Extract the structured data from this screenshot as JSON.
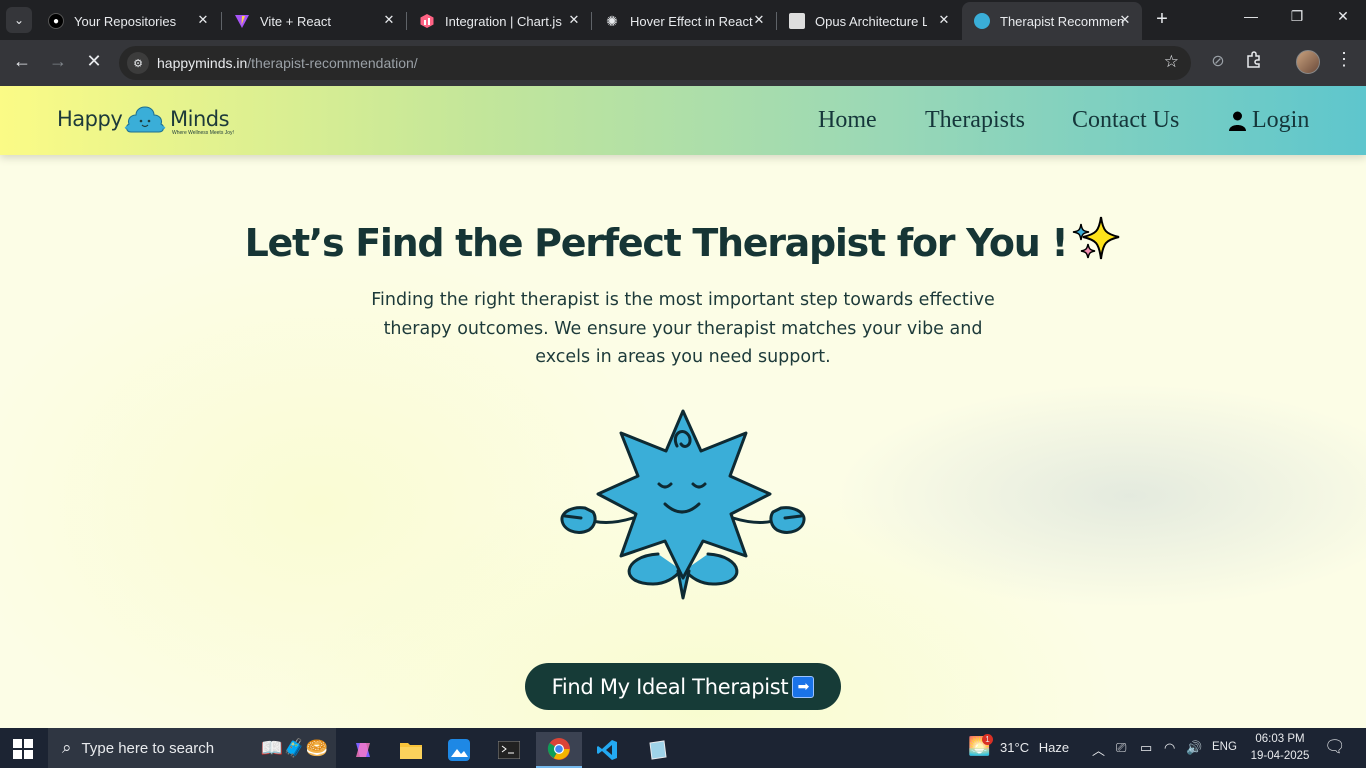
{
  "browser": {
    "tabs": [
      {
        "title": "Your Repositories",
        "icon": "github-icon"
      },
      {
        "title": "Vite + React",
        "icon": "vite-icon"
      },
      {
        "title": "Integration | Chart.js",
        "icon": "chartjs-icon"
      },
      {
        "title": "Hover Effect in React",
        "icon": "openai-icon"
      },
      {
        "title": "Opus Architecture La",
        "icon": "opus-icon"
      },
      {
        "title": "Therapist Recommen",
        "icon": "happyminds-icon",
        "active": true
      }
    ],
    "url_domain": "happyminds.in",
    "url_path": "/therapist-recommendation/"
  },
  "site": {
    "logo_left": "Happy",
    "logo_right": "Minds",
    "logo_tagline": "Where Wellness Meets Joy!",
    "nav": {
      "home": "Home",
      "therapists": "Therapists",
      "contact": "Contact Us",
      "login": "Login"
    },
    "hero": {
      "title_main": "Let’s Find the Perfect Therapist for ",
      "title_emphasis": "You",
      "title_end": " !",
      "subtitle": "Finding the right therapist is the most important step towards effective therapy outcomes. We ensure your therapist matches your vibe and excels in areas you need support.",
      "cta": "Find My Ideal Therapist"
    },
    "colors": {
      "header_start": "#fbfb86",
      "header_end": "#5ec6cd",
      "mascot": "#3aaed8",
      "cta_bg": "#163b37",
      "text_dark": "#163535"
    }
  },
  "taskbar": {
    "search_placeholder": "Type here to search",
    "weather_temp": "31°C",
    "weather_desc": "Haze",
    "weather_badge": "1",
    "language": "ENG",
    "time": "06:03 PM",
    "date": "19-04-2025"
  }
}
